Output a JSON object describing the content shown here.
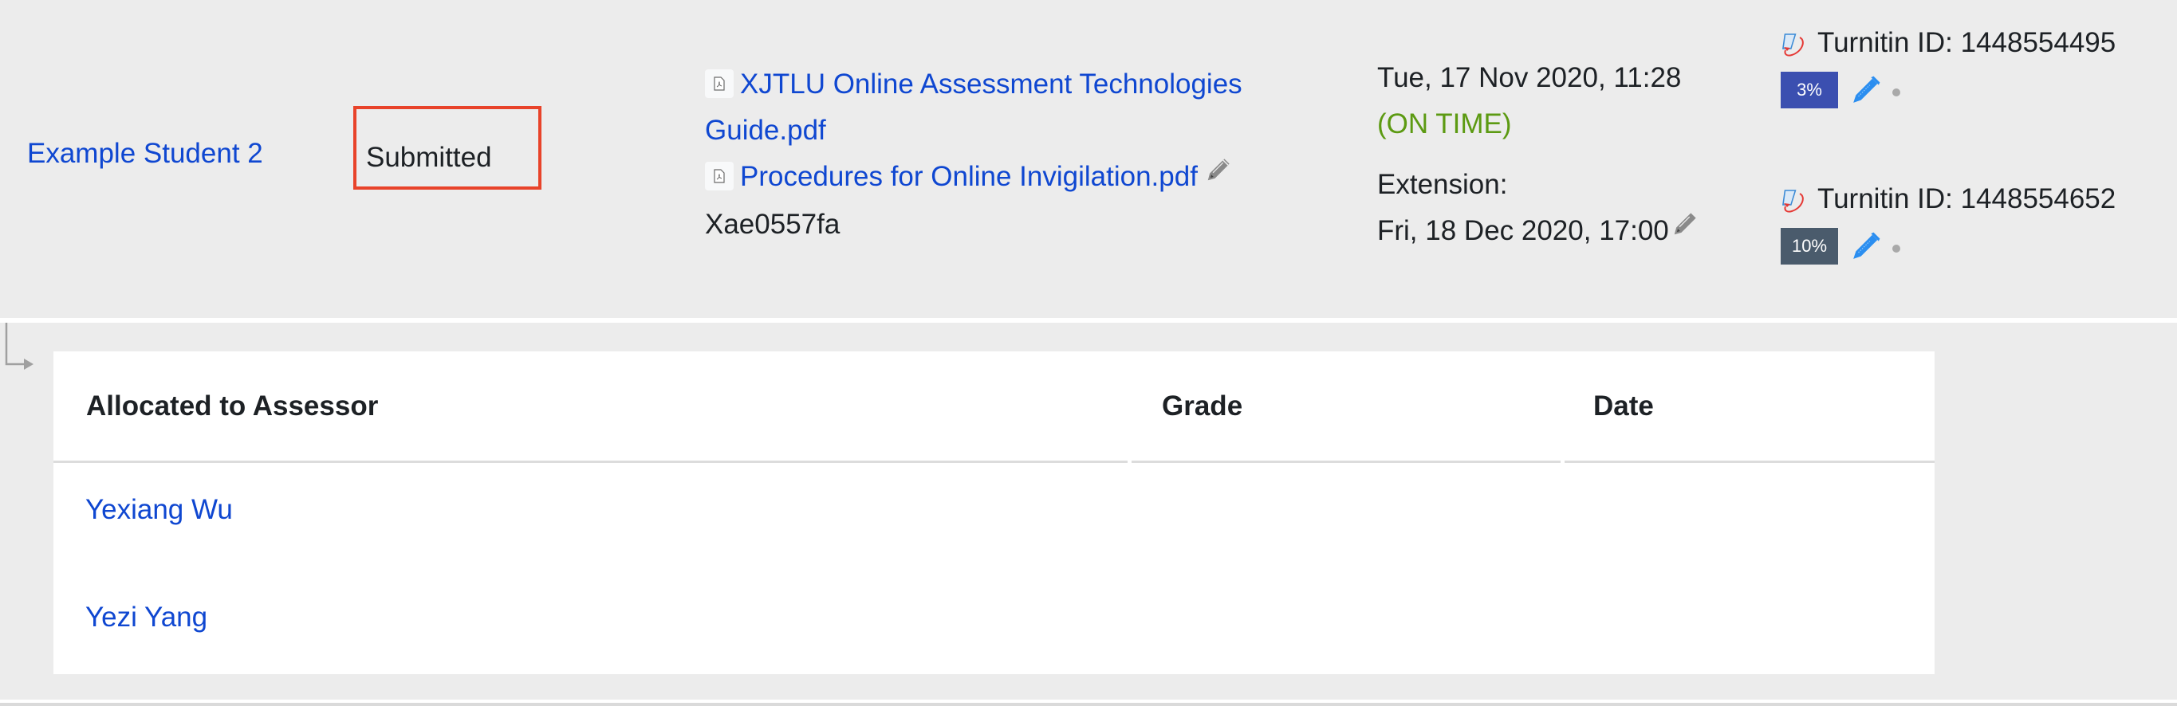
{
  "submission": {
    "student_name": "Example Student 2",
    "status": "Submitted",
    "status_highlight_color": "#e8432a",
    "files": [
      {
        "icon": "pdf-file-icon",
        "name_line1": "XJTLU Online Assessment Technologies",
        "name_line2": "Guide.pdf"
      },
      {
        "icon": "pdf-file-icon",
        "name": "Procedures for Online Invigilation.pdf"
      }
    ],
    "file_reference": "Xae0557fa",
    "submitted_date": "Tue, 17 Nov 2020, 11:28",
    "timeliness": "(ON TIME)",
    "extension_label": "Extension:",
    "extension_date": "Fri, 18 Dec 2020, 17:00",
    "turnitin": [
      {
        "label": "Turnitin ID: 1448554495",
        "similarity": "3%",
        "similarity_color": "#3b4fb0"
      },
      {
        "label": "Turnitin ID: 1448554652",
        "similarity": "10%",
        "similarity_color": "#4a5b6c"
      }
    ]
  },
  "assessor_table": {
    "columns": [
      "Allocated to Assessor",
      "Grade",
      "Date"
    ],
    "rows": [
      {
        "assessor": "Yexiang Wu",
        "grade": "",
        "date": ""
      },
      {
        "assessor": "Yezi Yang",
        "grade": "",
        "date": ""
      }
    ]
  },
  "colors": {
    "link": "#0f47d1",
    "on_time": "#5c9a12",
    "background": "#ececec"
  }
}
